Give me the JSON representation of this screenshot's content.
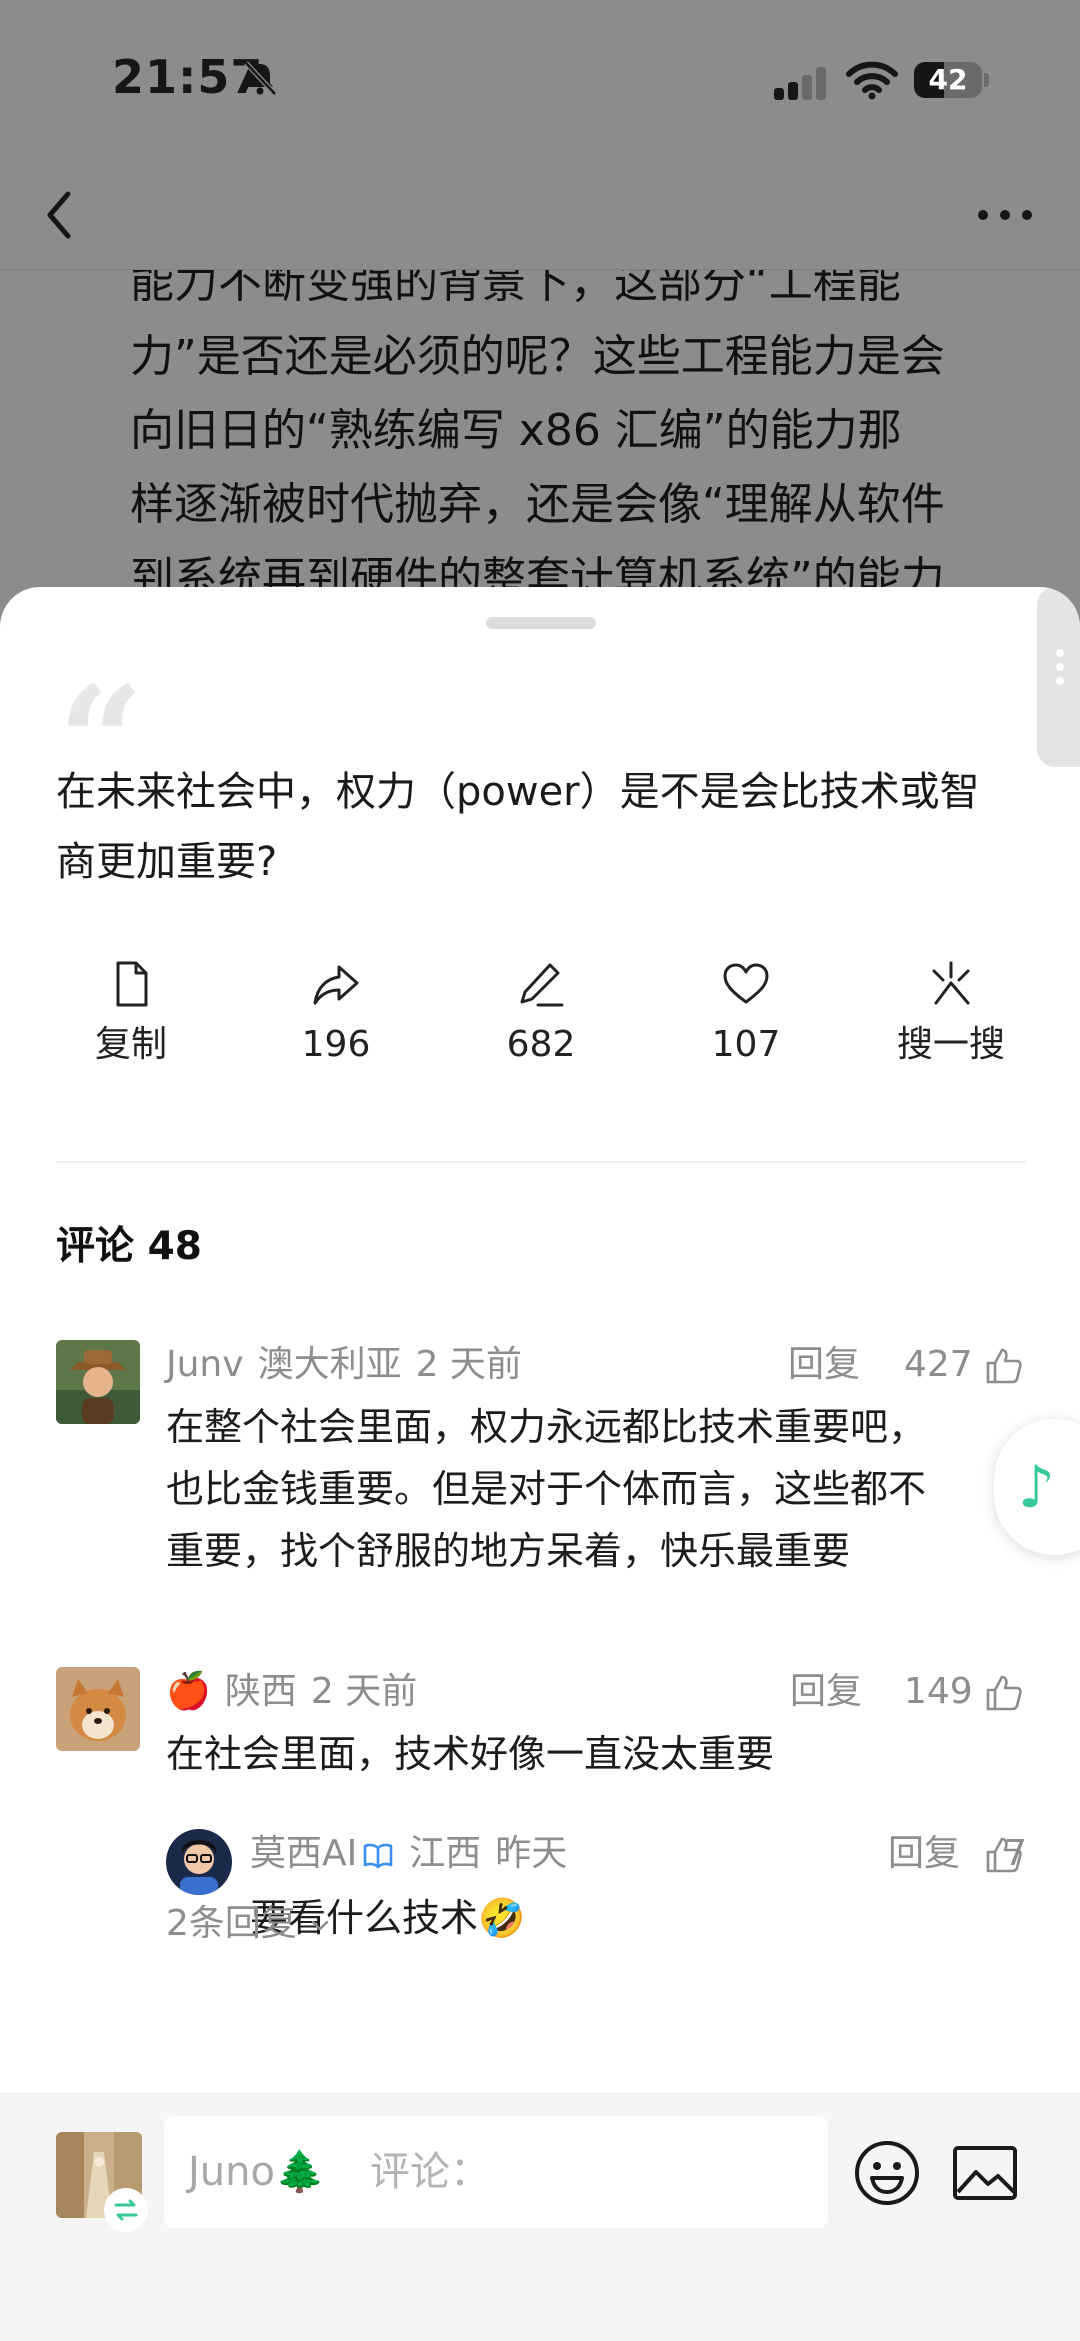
{
  "status_bar": {
    "time": "21:57",
    "battery": "42"
  },
  "article": {
    "lines": [
      "能力不断变强的背景下，这部分“工程能",
      "力”是否还是必须的呢？这些工程能力是会",
      "向旧日的“熟练编写 x86 汇编”的能力那",
      "样逐渐被时代抛弃，还是会像“理解从软件",
      "到系统再到硬件的整套计算机系统”的能力"
    ]
  },
  "quote": {
    "text_line1": "在未来社会中，权力（power）是不是会比技术或智",
    "text_line2": "商更加重要?"
  },
  "actions": [
    {
      "icon": "document-icon",
      "label": "复制"
    },
    {
      "icon": "share-icon",
      "label": "196"
    },
    {
      "icon": "pen-icon",
      "label": "682"
    },
    {
      "icon": "heart-icon",
      "label": "107"
    },
    {
      "icon": "search-sparkle-icon",
      "label": "搜一搜"
    }
  ],
  "comments": {
    "title": "评论 48",
    "reply_label": "回复",
    "items": [
      {
        "author": "Junv",
        "location": "澳大利亚",
        "time": "2 天前",
        "likes": "427",
        "lines": [
          "在整个社会里面，权力永远都比技术重要吧，",
          "也比金钱重要。但是对于个体而言，这些都不",
          "重要，找个舒服的地方呆着，快乐最重要"
        ]
      },
      {
        "author": "🍎",
        "location": "陕西",
        "time": "2 天前",
        "likes": "149",
        "lines": [
          "在社会里面，技术好像一直没太重要"
        ],
        "reply": {
          "author": "莫西AI",
          "location": "江西",
          "time": "昨天",
          "likes": "7",
          "text": "要看什么技术🤣"
        },
        "more_replies": "2条回复"
      }
    ]
  },
  "input_bar": {
    "username": "Juno🌲",
    "placeholder": "评论："
  },
  "colors": {
    "accent_green": "#36c79a",
    "verify_blue": "#3a8ef0"
  }
}
